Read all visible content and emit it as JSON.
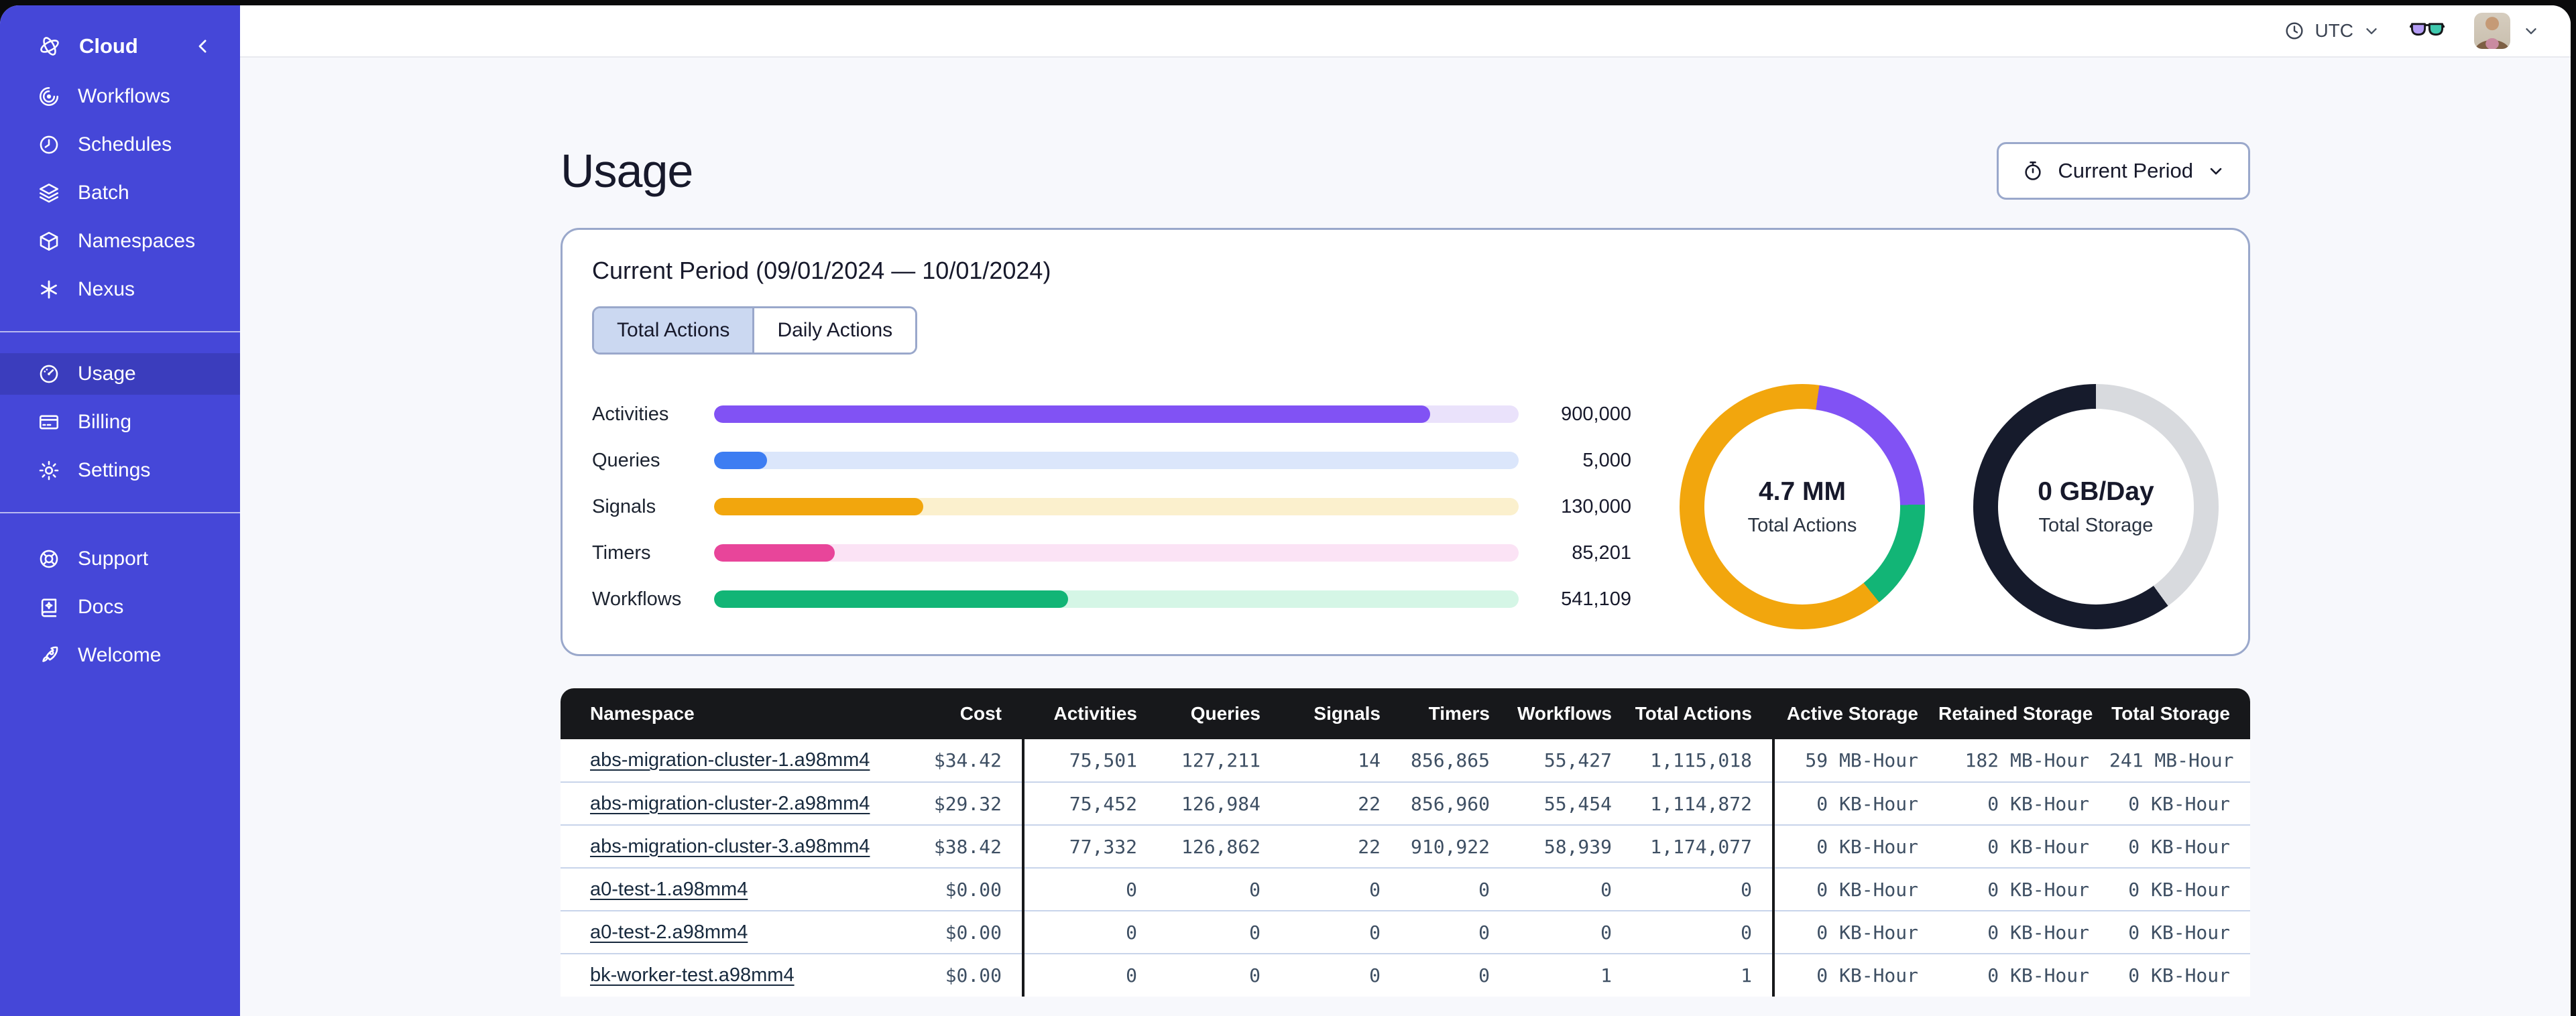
{
  "sidebar": {
    "brand_label": "Cloud",
    "brand_icon": "temporal-logo-icon",
    "collapse_icon": "chevron-left-icon",
    "groups": [
      {
        "items": [
          {
            "id": "workflows",
            "label": "Workflows",
            "icon": "workflows-icon",
            "active": false
          },
          {
            "id": "schedules",
            "label": "Schedules",
            "icon": "schedules-icon",
            "active": false
          },
          {
            "id": "batch",
            "label": "Batch",
            "icon": "batch-icon",
            "active": false
          },
          {
            "id": "namespaces",
            "label": "Namespaces",
            "icon": "namespaces-icon",
            "active": false
          },
          {
            "id": "nexus",
            "label": "Nexus",
            "icon": "nexus-icon",
            "active": false
          }
        ]
      },
      {
        "items": [
          {
            "id": "usage",
            "label": "Usage",
            "icon": "usage-icon",
            "active": true
          },
          {
            "id": "billing",
            "label": "Billing",
            "icon": "billing-icon",
            "active": false
          },
          {
            "id": "settings",
            "label": "Settings",
            "icon": "settings-icon",
            "active": false
          }
        ]
      },
      {
        "items": [
          {
            "id": "support",
            "label": "Support",
            "icon": "support-icon",
            "active": false
          },
          {
            "id": "docs",
            "label": "Docs",
            "icon": "docs-icon",
            "active": false
          },
          {
            "id": "welcome",
            "label": "Welcome",
            "icon": "welcome-icon",
            "active": false
          }
        ]
      }
    ]
  },
  "topbar": {
    "timezone": "UTC",
    "clock_icon": "clock-icon",
    "labs_icon": "glasses-icon",
    "menu_icon": "chevron-down-icon"
  },
  "page": {
    "title": "Usage",
    "period_button": {
      "icon": "stopwatch-icon",
      "label": "Current Period"
    }
  },
  "usage_card": {
    "title": "Current Period (09/01/2024 — 10/01/2024)",
    "tabs": [
      {
        "label": "Total Actions",
        "active": true
      },
      {
        "label": "Daily Actions",
        "active": false
      }
    ],
    "chart_data": {
      "type": "bar",
      "orientation": "horizontal",
      "categories": [
        "Activities",
        "Queries",
        "Signals",
        "Timers",
        "Workflows"
      ],
      "values": [
        900000,
        5000,
        130000,
        85201,
        541109
      ],
      "value_labels": [
        "900,000",
        "5,000",
        "130,000",
        "85,201",
        "541,109"
      ],
      "fill_pct": [
        89,
        6.6,
        26,
        15,
        44
      ],
      "colors": [
        "#8152F4",
        "#3D7DF2",
        "#F2A60D",
        "#E8459A",
        "#12B576"
      ],
      "track_colors": [
        "#EAE2FB",
        "#DBE6FB",
        "#FBF0CD",
        "#FBE3F5",
        "#D5F6E6"
      ]
    },
    "donuts": [
      {
        "value": "4.7 MM",
        "label": "Total Actions",
        "start_deg": 8,
        "segments": [
          {
            "name": "activities",
            "color": "#8152F4",
            "pct": 22.5
          },
          {
            "name": "workflows",
            "color": "#12B576",
            "pct": 14.5
          },
          {
            "name": "signals",
            "color": "#F2A60D",
            "pct": 63
          }
        ]
      },
      {
        "value": "0 GB/Day",
        "label": "Total Storage",
        "start_deg": 0,
        "segments": [
          {
            "name": "remaining",
            "color": "#D8DADE",
            "pct": 40
          },
          {
            "name": "used",
            "color": "#161B2C",
            "pct": 60
          }
        ]
      }
    ]
  },
  "table": {
    "columns": [
      {
        "key": "namespace",
        "label": "Namespace",
        "align": "left"
      },
      {
        "key": "cost",
        "label": "Cost",
        "align": "right"
      },
      {
        "key": "activities",
        "label": "Activities",
        "align": "right",
        "divider": true
      },
      {
        "key": "queries",
        "label": "Queries",
        "align": "right"
      },
      {
        "key": "signals",
        "label": "Signals",
        "align": "right"
      },
      {
        "key": "timers",
        "label": "Timers",
        "align": "right"
      },
      {
        "key": "workflows",
        "label": "Workflows",
        "align": "right"
      },
      {
        "key": "total_actions",
        "label": "Total Actions",
        "align": "right"
      },
      {
        "key": "active_storage",
        "label": "Active Storage",
        "align": "right",
        "divider": true
      },
      {
        "key": "retained_storage",
        "label": "Retained Storage",
        "align": "right"
      },
      {
        "key": "total_storage",
        "label": "Total Storage",
        "align": "right"
      }
    ],
    "rows": [
      {
        "namespace": "abs-migration-cluster-1.a98mm4",
        "cost": "$34.42",
        "activities": "75,501",
        "queries": "127,211",
        "signals": "14",
        "timers": "856,865",
        "workflows": "55,427",
        "total_actions": "1,115,018",
        "active_storage": "59 MB-Hour",
        "retained_storage": "182 MB-Hour",
        "total_storage": "241 MB-Hour"
      },
      {
        "namespace": "abs-migration-cluster-2.a98mm4",
        "cost": "$29.32",
        "activities": "75,452",
        "queries": "126,984",
        "signals": "22",
        "timers": "856,960",
        "workflows": "55,454",
        "total_actions": "1,114,872",
        "active_storage": "0 KB-Hour",
        "retained_storage": "0 KB-Hour",
        "total_storage": "0 KB-Hour"
      },
      {
        "namespace": "abs-migration-cluster-3.a98mm4",
        "cost": "$38.42",
        "activities": "77,332",
        "queries": "126,862",
        "signals": "22",
        "timers": "910,922",
        "workflows": "58,939",
        "total_actions": "1,174,077",
        "active_storage": "0 KB-Hour",
        "retained_storage": "0 KB-Hour",
        "total_storage": "0 KB-Hour"
      },
      {
        "namespace": "a0-test-1.a98mm4",
        "cost": "$0.00",
        "activities": "0",
        "queries": "0",
        "signals": "0",
        "timers": "0",
        "workflows": "0",
        "total_actions": "0",
        "active_storage": "0 KB-Hour",
        "retained_storage": "0 KB-Hour",
        "total_storage": "0 KB-Hour"
      },
      {
        "namespace": "a0-test-2.a98mm4",
        "cost": "$0.00",
        "activities": "0",
        "queries": "0",
        "signals": "0",
        "timers": "0",
        "workflows": "0",
        "total_actions": "0",
        "active_storage": "0 KB-Hour",
        "retained_storage": "0 KB-Hour",
        "total_storage": "0 KB-Hour"
      },
      {
        "namespace": "bk-worker-test.a98mm4",
        "cost": "$0.00",
        "activities": "0",
        "queries": "0",
        "signals": "0",
        "timers": "0",
        "workflows": "1",
        "total_actions": "1",
        "active_storage": "0 KB-Hour",
        "retained_storage": "0 KB-Hour",
        "total_storage": "0 KB-Hour"
      }
    ]
  }
}
